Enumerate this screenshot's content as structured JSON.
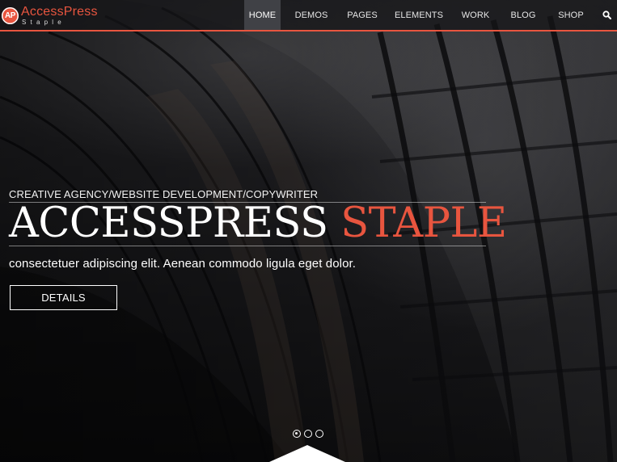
{
  "logo": {
    "mark": "AP",
    "name": "AccessPress",
    "sub": "Staple"
  },
  "nav": {
    "items": [
      {
        "label": "HOME",
        "active": true
      },
      {
        "label": "DEMOS"
      },
      {
        "label": "PAGES"
      },
      {
        "label": "ELEMENTS"
      },
      {
        "label": "WORK"
      },
      {
        "label": "BLOG"
      },
      {
        "label": "SHOP"
      }
    ],
    "search_icon": "search-icon"
  },
  "hero": {
    "tagline": "CREATIVE AGENCY/WEBSITE DEVELOPMENT/COPYWRITER",
    "title_white": "ACCESSPRESS",
    "title_accent": "STAPLE",
    "subtitle": "consectetuer adipiscing elit.  Aenean commodo ligula eget dolor.",
    "button_label": "DETAILS"
  },
  "slider": {
    "slide_count": 3,
    "active_index": 0
  },
  "colors": {
    "accent": "#e8553f",
    "header_bg": "#141416",
    "text": "#ffffff"
  }
}
